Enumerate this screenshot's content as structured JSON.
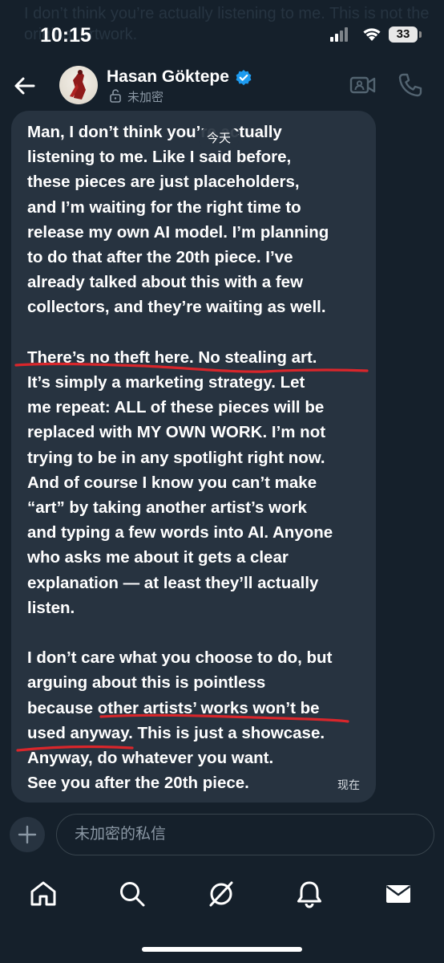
{
  "status_bar": {
    "time": "10:15",
    "battery": "33"
  },
  "header": {
    "contact_name": "Hasan Göktepe",
    "encryption_status": "未加密"
  },
  "background_text": "I don’t think you’re actually listening to me. This is not the original artwork.",
  "conversation": {
    "date_separator": "今天",
    "message": {
      "text": "Man, I don’t think you’re actually\nlistening to me. Like I said before,\nthese pieces are just placeholders,\nand I’m waiting for the right time to\nrelease my own AI model. I’m planning\nto do that after the 20th piece. I’ve\nalready talked about this with a few\ncollectors, and they’re waiting as well.\n\nThere’s no theft here. No stealing art.\nIt’s simply a marketing strategy. Let\nme repeat: ALL of these pieces will be\nreplaced with MY OWN WORK. I’m not\ntrying to be in any spotlight right now.\nAnd of course I know you can’t make\n“art” by taking another artist’s work\nand typing a few words into AI. Anyone\nwho asks me about it gets a clear\nexplanation — at least they’ll actually\nlisten.\n\nI don’t care what you choose to do, but\narguing about this is pointless\nbecause other artists’ works won’t be\nused anyway. This is just a showcase.\nAnyway, do whatever you want.\nSee you after the 20th piece.",
      "timestamp": "现在"
    }
  },
  "composer": {
    "placeholder": "未加密的私信"
  },
  "tabs": {
    "items": [
      {
        "icon": "home-icon"
      },
      {
        "icon": "search-icon"
      },
      {
        "icon": "grok-icon"
      },
      {
        "icon": "bell-icon"
      },
      {
        "icon": "mail-icon"
      }
    ]
  },
  "colors": {
    "background": "#15202b",
    "bubble": "#273340",
    "verified": "#1d9bf0",
    "annotation": "#d9262b",
    "muted": "#8b98a5"
  }
}
